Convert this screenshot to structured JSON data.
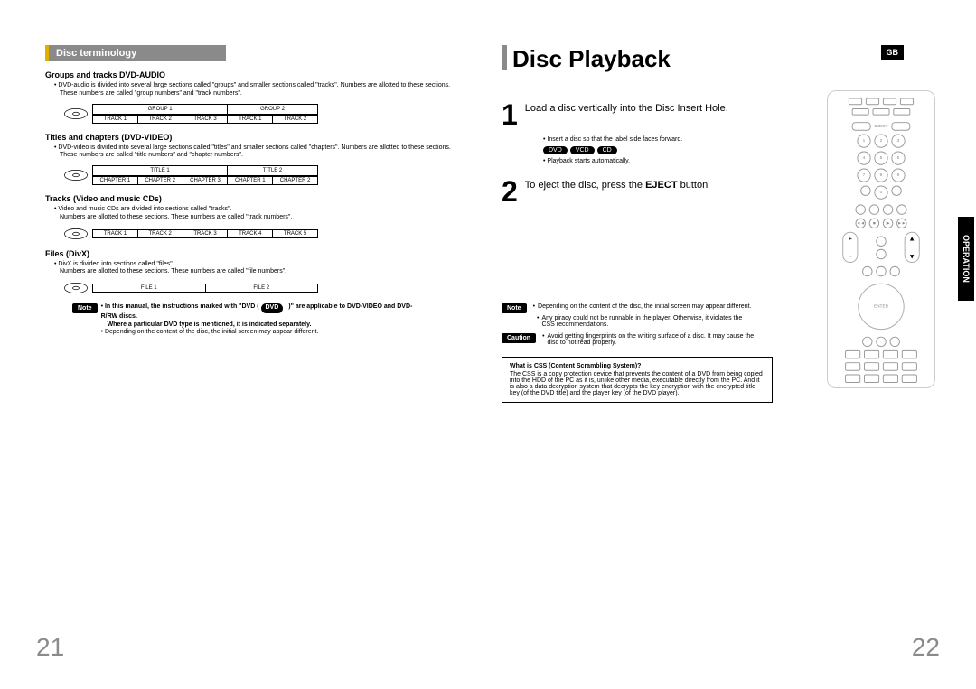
{
  "header": {
    "title": "Disc Playback",
    "lang_badge": "GB",
    "side_tab": "OPERATION"
  },
  "left": {
    "section_title": "Disc terminology",
    "groups": {
      "sub1": {
        "head": "Groups and tracks DVD-AUDIO",
        "body1": "DVD-audio is divided into several large sections called \"groups\" and smaller sections called \"tracks\". Numbers are allotted to these sections.",
        "body2": "These numbers are called \"group numbers\" and \"track numbers\".",
        "bar_top": [
          "GROUP 1",
          "GROUP 2"
        ],
        "bar_bot": [
          "TRACK 1",
          "TRACK 2",
          "TRACK 3",
          "TRACK 1",
          "TRACK 2"
        ]
      },
      "sub2": {
        "head": "Titles and chapters (DVD-VIDEO)",
        "body1": "DVD-video is divided into several large sections called \"titles\" and smaller sections called \"chapters\". Numbers are allotted to these sections.",
        "body2": "These numbers are called \"title numbers\" and \"chapter numbers\".",
        "bar_top": [
          "TITLE 1",
          "TITLE 2"
        ],
        "bar_bot": [
          "CHAPTER 1",
          "CHAPTER 2",
          "CHAPTER 3",
          "CHAPTER 1",
          "CHAPTER 2"
        ]
      },
      "sub3": {
        "head": "Tracks (Video and music CDs)",
        "body1": "Video and music CDs are divided into sections called \"tracks\".",
        "body2": "Numbers are allotted to these sections. These numbers are called \"track numbers\".",
        "bar": [
          "TRACK 1",
          "TRACK 2",
          "TRACK 3",
          "TRACK 4",
          "TRACK 5"
        ]
      },
      "sub4": {
        "head": "Files (DivX)",
        "body1": "DivX is divided into sections called \"files\".",
        "body2": "Numbers are allotted to these sections. These numbers are called \"file numbers\".",
        "bar": [
          "FILE 1",
          "FILE 2"
        ]
      }
    },
    "note": {
      "label": "Note",
      "line1a": "In this manual, the instructions marked with \"DVD (",
      "line1_pill": "DVD",
      "line1b": ")\" are applicable to DVD-VIDEO and DVD-R/RW discs.",
      "line2": "Where a particular DVD type is mentioned, it is indicated separately.",
      "line3": "Depending on the content of the disc, the initial screen may appear different."
    },
    "pagenum": "21"
  },
  "right": {
    "step1": {
      "num": "1",
      "text_a": "Load a disc vertically into the Disc Insert Hole.",
      "sub": "Insert a disc so that the label side faces forward.",
      "pills": [
        "DVD",
        "VCD",
        "CD"
      ],
      "after": "Playback starts automatically."
    },
    "step2": {
      "num": "2",
      "text_a": "To eject the disc, press the ",
      "text_b": "EJECT",
      "text_c": " button"
    },
    "note": {
      "label": "Note",
      "l1": "Depending on the content of the disc, the initial screen may appear different.",
      "l2": "Any piracy could not be runnable in the player. Otherwise, it violates the CSS recommendations."
    },
    "caution": {
      "label": "Caution",
      "l1": "Avoid getting fingerprints on the writing surface of a disc. It may cause the disc to not read properly."
    },
    "css_box": {
      "head": "What is CSS (Content Scrambling System)?",
      "body": "The CSS is a copy protection device that prevents the content of a DVD from being copied into the HDD of the PC as it is, unlike other media, executable directly from the PC. And it is also a data decryption system that decrypts the key encryption with the encrypted title key (of the DVD title) and the player key (of the DVD player)."
    },
    "pagenum": "22"
  }
}
